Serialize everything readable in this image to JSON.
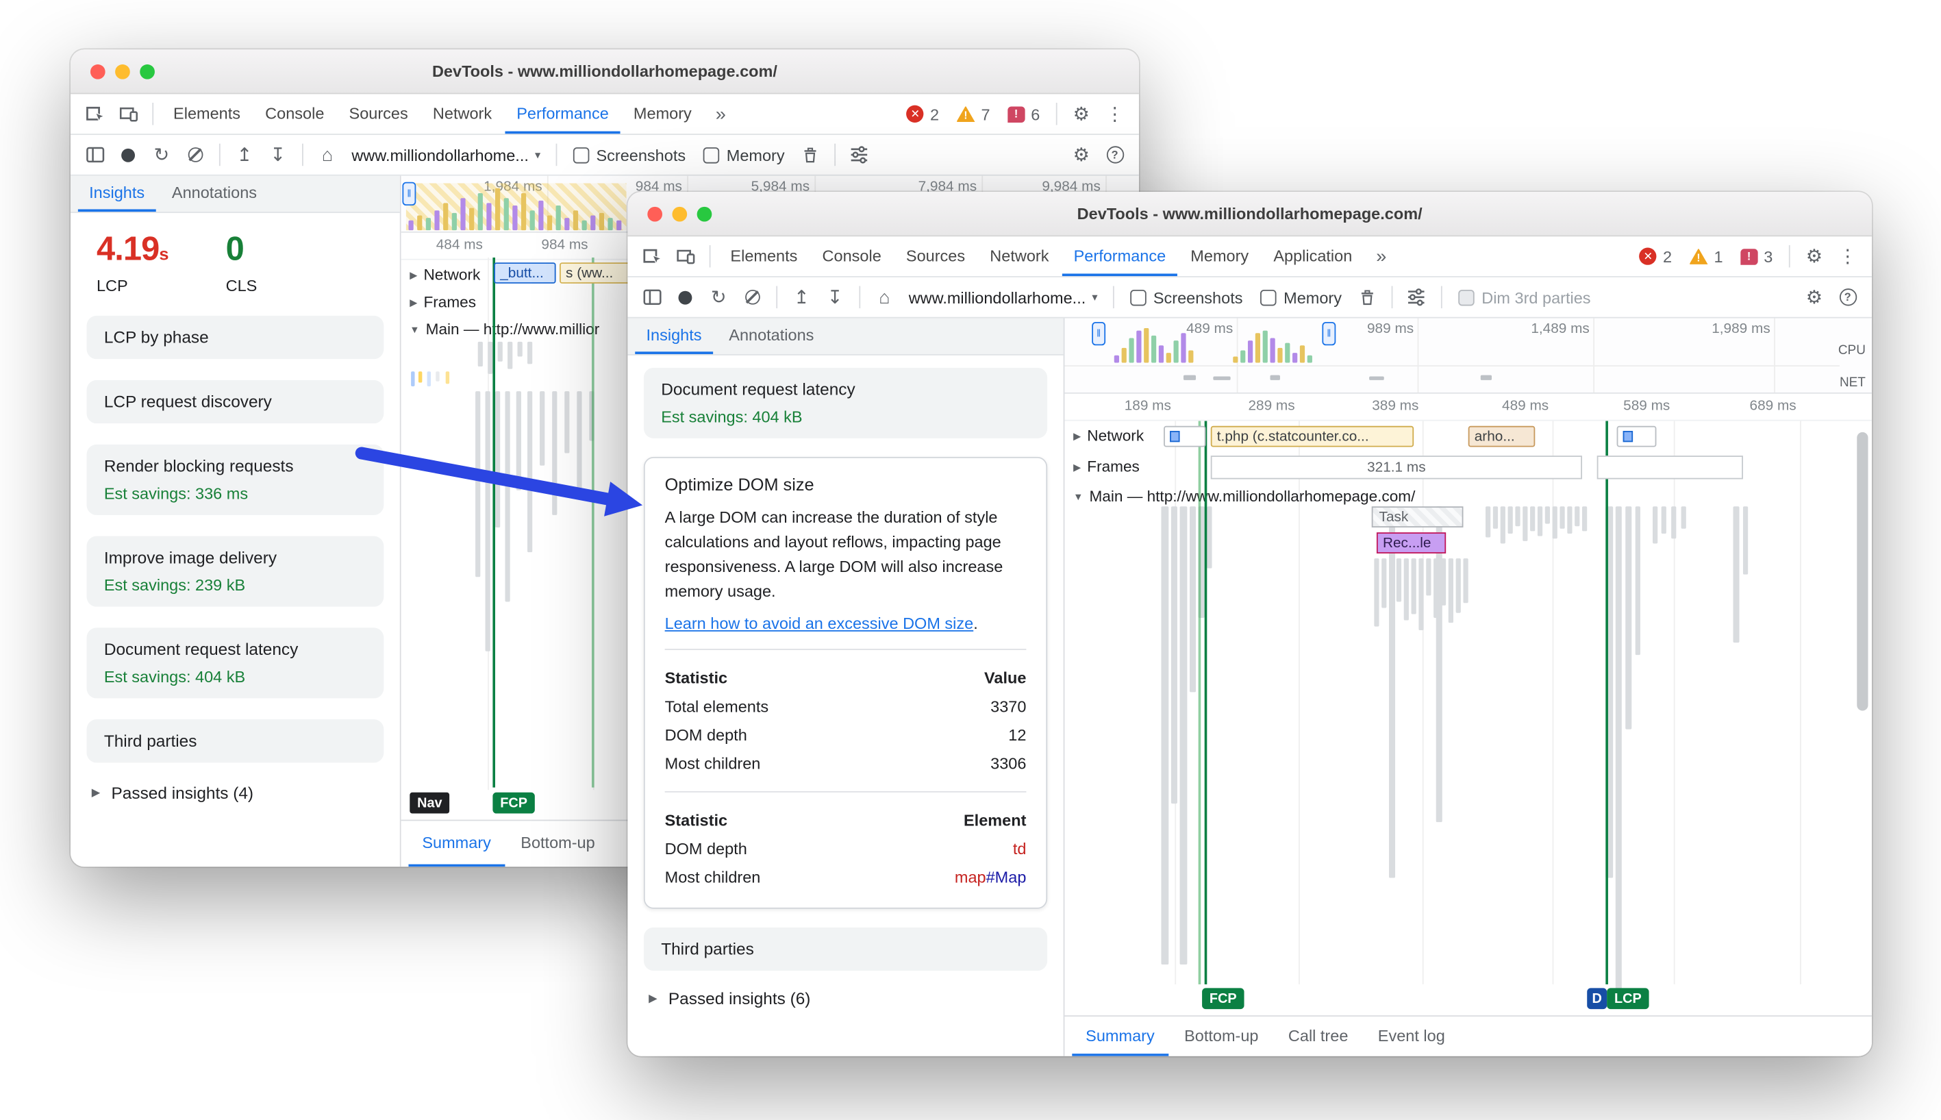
{
  "colors": {
    "accent_blue": "#1a73e8",
    "lcp_red": "#d93025",
    "cls_green": "#188038",
    "savings_green": "#188038",
    "marker_green": "#0b8043",
    "arrow_blue": "#2b45e2"
  },
  "icons": {
    "error": "✕",
    "warning": "!",
    "issues": "!",
    "reload": "↻",
    "upload": "↥",
    "download": "↧",
    "home": "⌂",
    "gear": "⚙",
    "kebab": "⋮",
    "more_tabs": "»",
    "help": "?",
    "caret_down": "▾",
    "disclosure_closed": "▶",
    "disclosure_open": "▼",
    "pause": "‖"
  },
  "back_window": {
    "titlebar": {
      "title": "DevTools - www.milliondollarhomepage.com/"
    },
    "tabs": [
      {
        "label": "Elements"
      },
      {
        "label": "Console"
      },
      {
        "label": "Sources"
      },
      {
        "label": "Network"
      },
      {
        "label": "Performance"
      },
      {
        "label": "Memory"
      }
    ],
    "badges": {
      "errors": "2",
      "warnings": "7",
      "issues": "6"
    },
    "toolbar": {
      "url": "www.milliondollarhome...",
      "screenshots": "Screenshots",
      "memory": "Memory"
    },
    "overview_labels": [
      "1,984 ms",
      "984 ms",
      "5,984 ms",
      "7,984 ms",
      "9,984 ms"
    ],
    "panel_tabs": {
      "insights": "Insights",
      "annotations": "Annotations"
    },
    "metrics": {
      "lcp_value": "4.19",
      "lcp_unit": "s",
      "lcp_label": "LCP",
      "cls_value": "0",
      "cls_label": "CLS"
    },
    "cards": {
      "lcp_phase": {
        "title": "LCP by phase"
      },
      "lcp_discovery": {
        "title": "LCP request discovery"
      },
      "render_blocking": {
        "title": "Render blocking requests",
        "savings": "Est savings: 336 ms"
      },
      "image_delivery": {
        "title": "Improve image delivery",
        "savings": "Est savings: 239 kB"
      },
      "doc_latency": {
        "title": "Document request latency",
        "savings": "Est savings: 404 kB"
      },
      "third_parties": {
        "title": "Third parties"
      }
    },
    "passed_insights": "Passed insights (4)",
    "flame": {
      "ruler": [
        "484 ms",
        "984 ms"
      ],
      "network_label": "Network",
      "net_item_1": "_butt...",
      "net_item_2": "s (ww...",
      "frames_label": "Frames",
      "main_label": "Main — http://www.millior",
      "nav_badge": "Nav",
      "fcp_badge": "FCP"
    },
    "bottom_tabs": [
      {
        "label": "Summary"
      },
      {
        "label": "Bottom-up"
      }
    ]
  },
  "front_window": {
    "titlebar": {
      "title": "DevTools - www.milliondollarhomepage.com/"
    },
    "tabs": [
      {
        "label": "Elements"
      },
      {
        "label": "Console"
      },
      {
        "label": "Sources"
      },
      {
        "label": "Network"
      },
      {
        "label": "Performance"
      },
      {
        "label": "Memory"
      },
      {
        "label": "Application"
      }
    ],
    "badges": {
      "errors": "2",
      "warnings": "1",
      "issues": "3"
    },
    "toolbar": {
      "url": "www.milliondollarhome...",
      "screenshots": "Screenshots",
      "memory": "Memory",
      "dim_third_parties": "Dim 3rd parties"
    },
    "overview_labels": [
      "489 ms",
      "989 ms",
      "1,489 ms",
      "1,989 ms"
    ],
    "overview_side": {
      "cpu": "CPU",
      "net": "NET"
    },
    "panel_tabs": {
      "insights": "Insights",
      "annotations": "Annotations"
    },
    "cards": {
      "doc_latency": {
        "title": "Document request latency",
        "savings": "Est savings: 404 kB"
      },
      "optimize_dom": {
        "title": "Optimize DOM size",
        "description": "A large DOM can increase the duration of style calculations and layout reflows, impacting page responsiveness. A large DOM will also increase memory usage.",
        "link": "Learn how to avoid an excessive DOM size",
        "link_suffix": ".",
        "value_table": {
          "col_label": "Statistic",
          "col_value": "Value",
          "rows": [
            {
              "label": "Total elements",
              "value": "3370"
            },
            {
              "label": "DOM depth",
              "value": "12"
            },
            {
              "label": "Most children",
              "value": "3306"
            }
          ]
        },
        "element_table": {
          "col_label": "Statistic",
          "col_value": "Element",
          "dom_depth": {
            "label": "DOM depth",
            "value": "td"
          },
          "most_children": {
            "label": "Most children",
            "tag": "map",
            "id": "#Map"
          }
        }
      },
      "third_parties": {
        "title": "Third parties"
      }
    },
    "passed_insights": "Passed insights (6)",
    "flame": {
      "ruler": [
        "189 ms",
        "289 ms",
        "389 ms",
        "489 ms",
        "589 ms",
        "689 ms"
      ],
      "network_label": "Network",
      "net_item_main": "t.php (c.statcounter.co...",
      "net_item_2": "arho...",
      "frames_label": "Frames",
      "frames_value": "321.1 ms",
      "main_label": "Main — http://www.milliondollarhomepage.com/",
      "task_label": "Task",
      "recalc_label": "Rec...le",
      "fcp_badge": "FCP",
      "dcl_badge": "D",
      "lcp_badge": "LCP"
    },
    "bottom_tabs": [
      {
        "label": "Summary"
      },
      {
        "label": "Bottom-up"
      },
      {
        "label": "Call tree"
      },
      {
        "label": "Event log"
      }
    ]
  }
}
